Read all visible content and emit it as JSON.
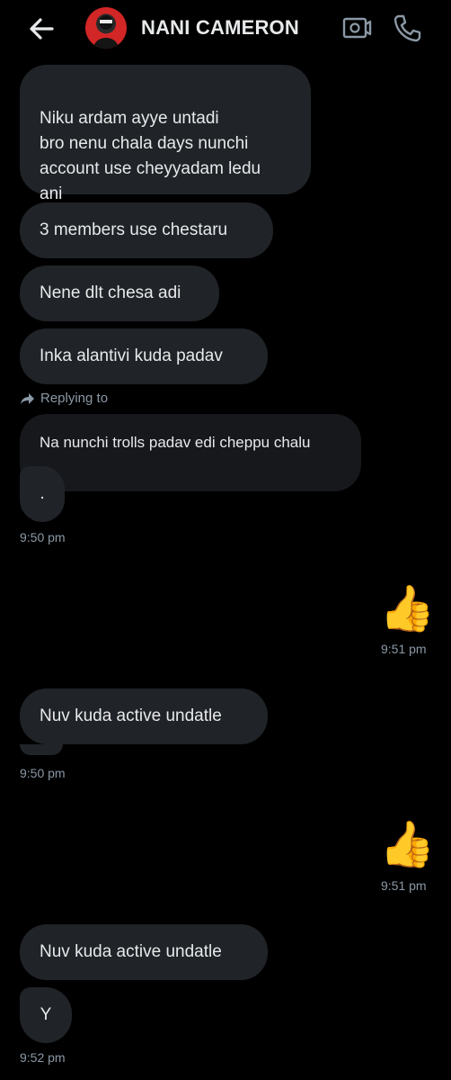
{
  "header": {
    "title": "NANI CAMERON",
    "back_icon": "arrow-left-icon",
    "video_icon": "video-call-icon",
    "call_icon": "phone-icon"
  },
  "messages": {
    "m1": "Niku ardam ayye untadi\nbro nenu chala days nunchi\naccount use cheyyadam ledu\nani",
    "m2": "3 members use chestaru",
    "m3": "Nene dlt chesa adi",
    "m4": "Inka alantivi kuda padav",
    "reply_label": "Replying to",
    "quoted": "Na nunchi trolls padav edi cheppu chalu",
    "dot": ".",
    "time1": "9:50 pm",
    "thumb1": "👍",
    "time2": "9:51 pm",
    "m5": "Nuv kuda active undatle",
    "time3": "9:50 pm",
    "thumb2": "👍",
    "time4": "9:51 pm",
    "m6": "Nuv kuda active undatle",
    "m7": "Y",
    "time5": "9:52 pm"
  },
  "colors": {
    "background": "#000000",
    "bubble": "#202327",
    "text": "#e7e9ea",
    "muted": "#8b98a5"
  }
}
